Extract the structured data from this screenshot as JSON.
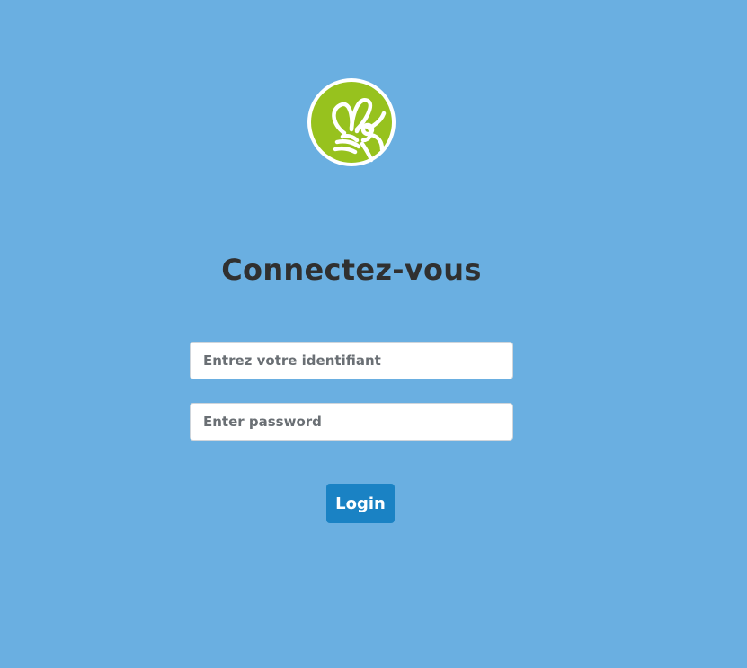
{
  "logo": {
    "icon": "bee-icon",
    "color": "#97c21e"
  },
  "page": {
    "title": "Connectez-vous"
  },
  "form": {
    "username_placeholder": "Entrez votre identifiant",
    "password_placeholder": "Enter password",
    "login_label": "Login"
  },
  "colors": {
    "background": "#6aafe1",
    "button": "#1a82c4",
    "title": "#303030"
  }
}
